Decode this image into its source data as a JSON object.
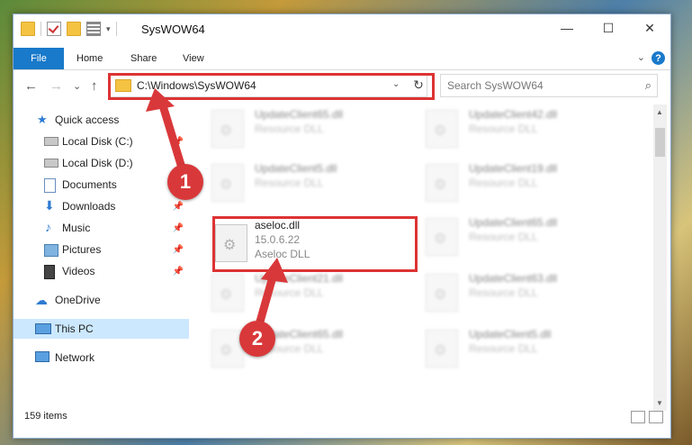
{
  "window": {
    "title": "SysWOW64",
    "controls": [
      "—",
      "☐",
      "✕"
    ]
  },
  "ribbon": {
    "file_tab": "File",
    "tabs": [
      "Home",
      "Share",
      "View"
    ],
    "help": "?"
  },
  "navigation": {
    "back": "←",
    "forward": "→",
    "recent": "⌄",
    "up": "↑",
    "address": "C:\\Windows\\SysWOW64",
    "refresh": "↻",
    "search_placeholder": "Search SysWOW64",
    "search_icon": "⌕"
  },
  "sidebar": {
    "items": [
      {
        "label": "Quick access",
        "icon": "star-icon"
      },
      {
        "label": "Local Disk (C:)",
        "icon": "drive-icon",
        "pinned": true
      },
      {
        "label": "Local Disk (D:)",
        "icon": "drive-icon"
      },
      {
        "label": "Documents",
        "icon": "documents-icon",
        "pinned": true
      },
      {
        "label": "Downloads",
        "icon": "downloads-icon",
        "pinned": true
      },
      {
        "label": "Music",
        "icon": "music-icon",
        "pinned": true
      },
      {
        "label": "Pictures",
        "icon": "pictures-icon",
        "pinned": true
      },
      {
        "label": "Videos",
        "icon": "videos-icon",
        "pinned": true
      },
      {
        "label": "OneDrive",
        "icon": "cloud-icon"
      },
      {
        "label": "This PC",
        "icon": "computer-icon",
        "selected": true
      },
      {
        "label": "Network",
        "icon": "network-icon"
      }
    ]
  },
  "files": [
    {
      "name": "UpdateClient65.dll",
      "type": "Resource DLL"
    },
    {
      "name": "UpdateClient42.dll",
      "type": "Resource DLL"
    },
    {
      "name": "UpdateClient5.dll",
      "type": "Resource DLL"
    },
    {
      "name": "UpdateClient19.dll",
      "type": "Resource DLL"
    },
    {
      "name": "aseloc.dll",
      "version": "15.0.6.22",
      "type": "Aseloc DLL"
    },
    {
      "name": "UpdateClient65.dll",
      "type": "Resource DLL"
    },
    {
      "name": "UpdateClient21.dll",
      "type": "Resource DLL"
    },
    {
      "name": "UpdateClient63.dll",
      "type": "Resource DLL"
    },
    {
      "name": "UpdateClient65.dll",
      "type": "Resource DLL"
    },
    {
      "name": "UpdateClient5.dll",
      "type": "Resource DLL"
    }
  ],
  "status": {
    "item_count": "159 items"
  },
  "callouts": [
    "1",
    "2"
  ],
  "colors": {
    "accent": "#1979ca",
    "highlight": "#d33333",
    "selected": "#cce8ff"
  }
}
